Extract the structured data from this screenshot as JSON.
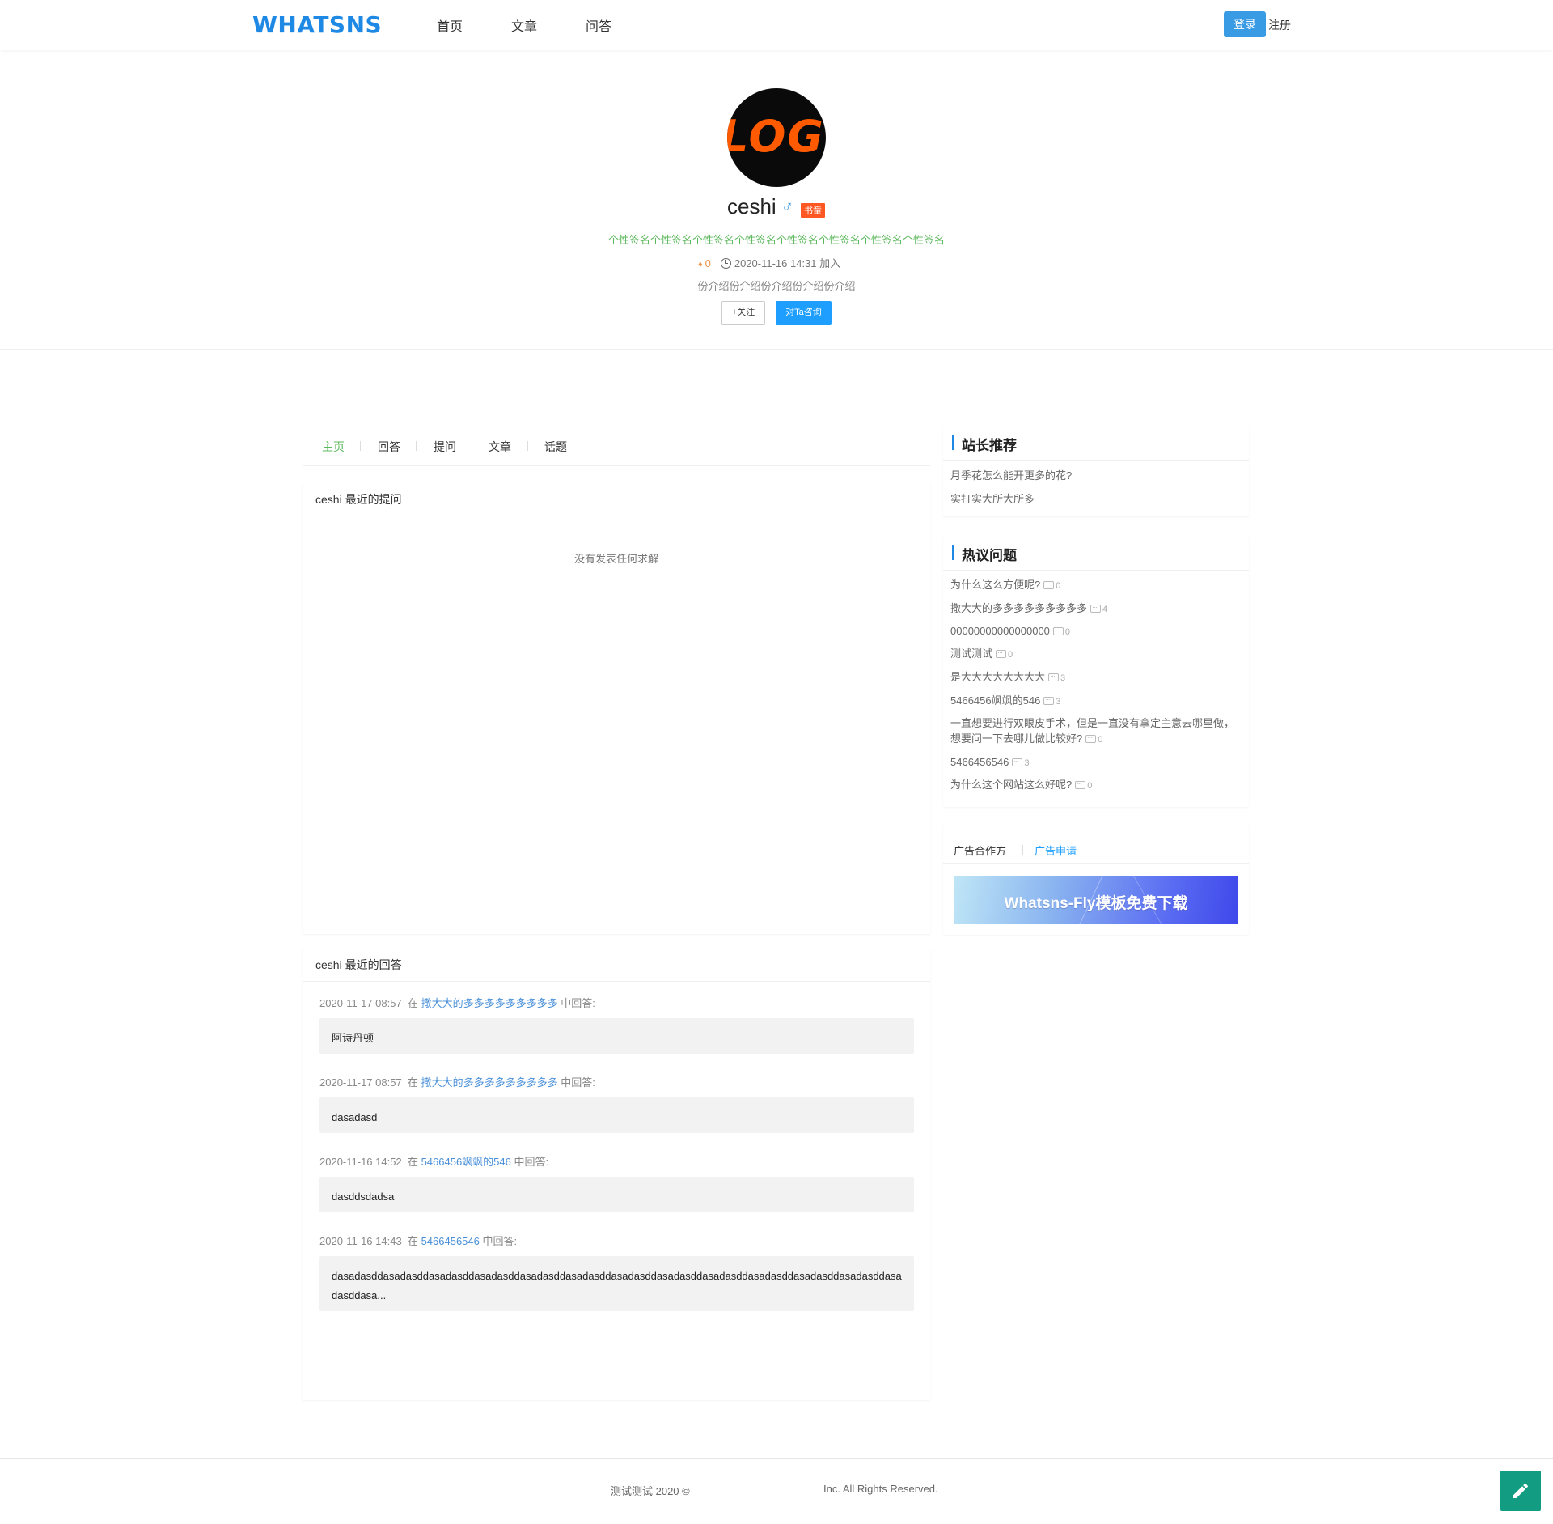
{
  "header": {
    "logo": "WHATSNS",
    "nav": [
      "首页",
      "文章",
      "问答"
    ],
    "login_label": "登录",
    "register_label": "注册"
  },
  "profile": {
    "avatar_text": "LOGO",
    "username": "ceshi",
    "gender_symbol": "♂",
    "role_badge": "书童",
    "signature": "个性签名个性签名个性签名个性签名个性签名个性签名个性签名个性签名",
    "gem_count": "0",
    "join_text": "2020-11-16 14:31 加入",
    "intro": "份介绍份介绍份介绍份介绍份介绍",
    "follow_label": "+关注",
    "consult_label": "对Ta咨询"
  },
  "tabs": [
    "主页",
    "回答",
    "提问",
    "文章",
    "话题"
  ],
  "questions_panel": {
    "title": "ceshi 最近的提问",
    "empty_text": "没有发表任何求解"
  },
  "answers_panel": {
    "title": "ceshi 最近的回答",
    "in_word": "在",
    "suffix": "中回答:",
    "items": [
      {
        "time": "2020-11-17 08:57",
        "question": "撒大大的多多多多多多多多多",
        "content": "阿诗丹顿"
      },
      {
        "time": "2020-11-17 08:57",
        "question": "撒大大的多多多多多多多多多",
        "content": "dasadasd"
      },
      {
        "time": "2020-11-16 14:52",
        "question": "5466456飒飒的546",
        "content": "dasddsdadsa"
      },
      {
        "time": "2020-11-16 14:43",
        "question": "5466456546",
        "content": "dasadasddasadasddasadasddasadasddasadasddasadasddasadasddasadasddasadasddasadasddasadasddasadasddasa dasddasa..."
      }
    ]
  },
  "sidebar": {
    "recommend_title": "站长推荐",
    "recommend_items": [
      "月季花怎么能开更多的花?",
      "实打实大所大所多"
    ],
    "hot_title": "热议问题",
    "hot_items": [
      {
        "title": "为什么这么方便呢?",
        "count": "0"
      },
      {
        "title": "撒大大的多多多多多多多多多",
        "count": "4"
      },
      {
        "title": "00000000000000000",
        "count": "0"
      },
      {
        "title": "测试测试",
        "count": "0"
      },
      {
        "title": "是大大大大大大大大",
        "count": "3"
      },
      {
        "title": "5466456飒飒的546",
        "count": "3"
      },
      {
        "title": "一直想要进行双眼皮手术，但是一直没有拿定主意去哪里做，想要问一下去哪儿做比较好?",
        "count": "0"
      },
      {
        "title": "5466456546",
        "count": "3"
      },
      {
        "title": "为什么这个网站这么好呢?",
        "count": "0"
      }
    ],
    "ad_tab_1": "广告合作方",
    "ad_tab_2": "广告申请",
    "ad_banner_text": "Whatsns-Fly模板免费下载"
  },
  "footer": {
    "left": "测试测试   2020 ©",
    "right": "Inc. All Rights Reserved."
  },
  "colors": {
    "brand": "#1E88E5",
    "green": "#5cb85c",
    "fab": "#129c82"
  }
}
